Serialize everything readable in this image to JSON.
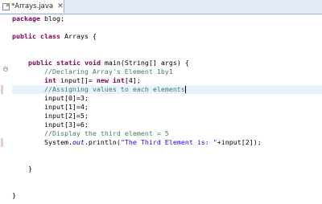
{
  "editor": {
    "tab_title": "*Arrays.java",
    "tab_close": "✕",
    "fold_glyph": "−"
  },
  "code": {
    "pkg_kw": "package",
    "pkg_name": " blog;",
    "class_kw1": "public",
    "class_kw2": "class",
    "class_name": " Arrays {",
    "main_kw1": "public",
    "main_kw2": "static",
    "main_kw3": "void",
    "main_sig": " main(String[] args) {",
    "comment1": "//Declaring Array's Element 1by1",
    "decl_kw1": "int",
    "decl_mid": " input[]= ",
    "decl_kw2": "new",
    "decl_kw3": "int",
    "decl_end": "[4];",
    "comment2": "//Assigning values to each elements",
    "assign0": "input[0]=3;",
    "assign1": "input[1]=4;",
    "assign2": "input[2]=5;",
    "assign3": "input[3]=6;",
    "comment3": "//Display the third element = 5",
    "print_pre": "System.",
    "print_out": "out",
    "print_mid": ".println(",
    "print_str": "\"The Third Element is: \"",
    "print_end": "+input[2]);",
    "close_method": "}",
    "close_class": "}"
  },
  "colors": {
    "keyword": "#7f0055",
    "comment": "#3f7f5f",
    "string": "#2a00ff",
    "field": "#0000c0",
    "current_line": "#e8f2fe"
  }
}
